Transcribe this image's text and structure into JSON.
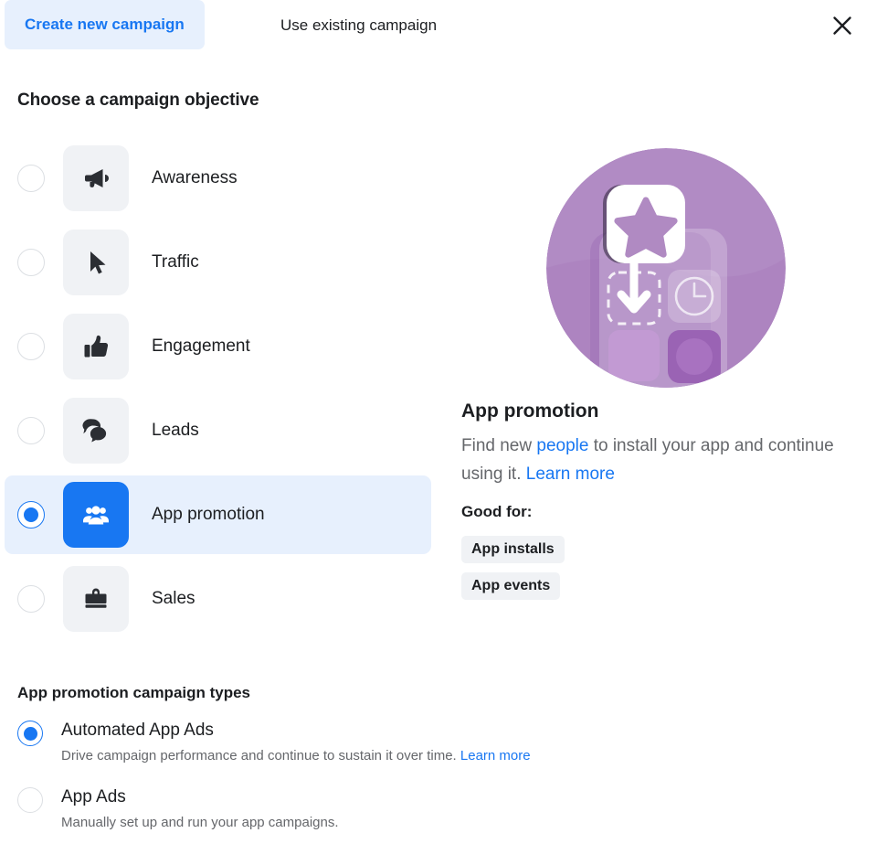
{
  "tabs": [
    {
      "label": "Create new campaign",
      "active": true,
      "name": "tab-create-new-campaign"
    },
    {
      "label": "Use existing campaign",
      "active": false,
      "name": "tab-use-existing-campaign"
    }
  ],
  "close_icon": "close-icon",
  "objective_section": {
    "heading": "Choose a campaign objective",
    "items": [
      {
        "label": "Awareness",
        "icon": "megaphone-icon",
        "selected": false
      },
      {
        "label": "Traffic",
        "icon": "cursor-icon",
        "selected": false
      },
      {
        "label": "Engagement",
        "icon": "thumbs-up-icon",
        "selected": false
      },
      {
        "label": "Leads",
        "icon": "chat-bubbles-icon",
        "selected": false
      },
      {
        "label": "App promotion",
        "icon": "people-group-icon",
        "selected": true
      },
      {
        "label": "Sales",
        "icon": "briefcase-icon",
        "selected": false
      }
    ]
  },
  "detail": {
    "illustration_name": "app-promotion-illustration",
    "title": "App promotion",
    "desc_part1": "Find new ",
    "desc_link1": "people",
    "desc_part2": " to install your app and continue using it. ",
    "desc_link2": "Learn more",
    "good_for_label": "Good for:",
    "tags": [
      "App installs",
      "App events"
    ]
  },
  "campaign_types": {
    "heading": "App promotion campaign types",
    "options": [
      {
        "title": "Automated App Ads",
        "desc": "Drive campaign performance and continue to sustain it over time. ",
        "link": "Learn more",
        "selected": true
      },
      {
        "title": "App Ads",
        "desc": "Manually set up and run your app campaigns.",
        "link": "",
        "selected": false
      }
    ]
  },
  "colors": {
    "accent_blue": "#1877f2",
    "selected_row_bg": "#e7f0fd",
    "tile_gray": "#f0f2f5",
    "text_primary": "#1c1e21",
    "text_secondary": "#65676b",
    "illustration_purple": "#b18bc4"
  }
}
